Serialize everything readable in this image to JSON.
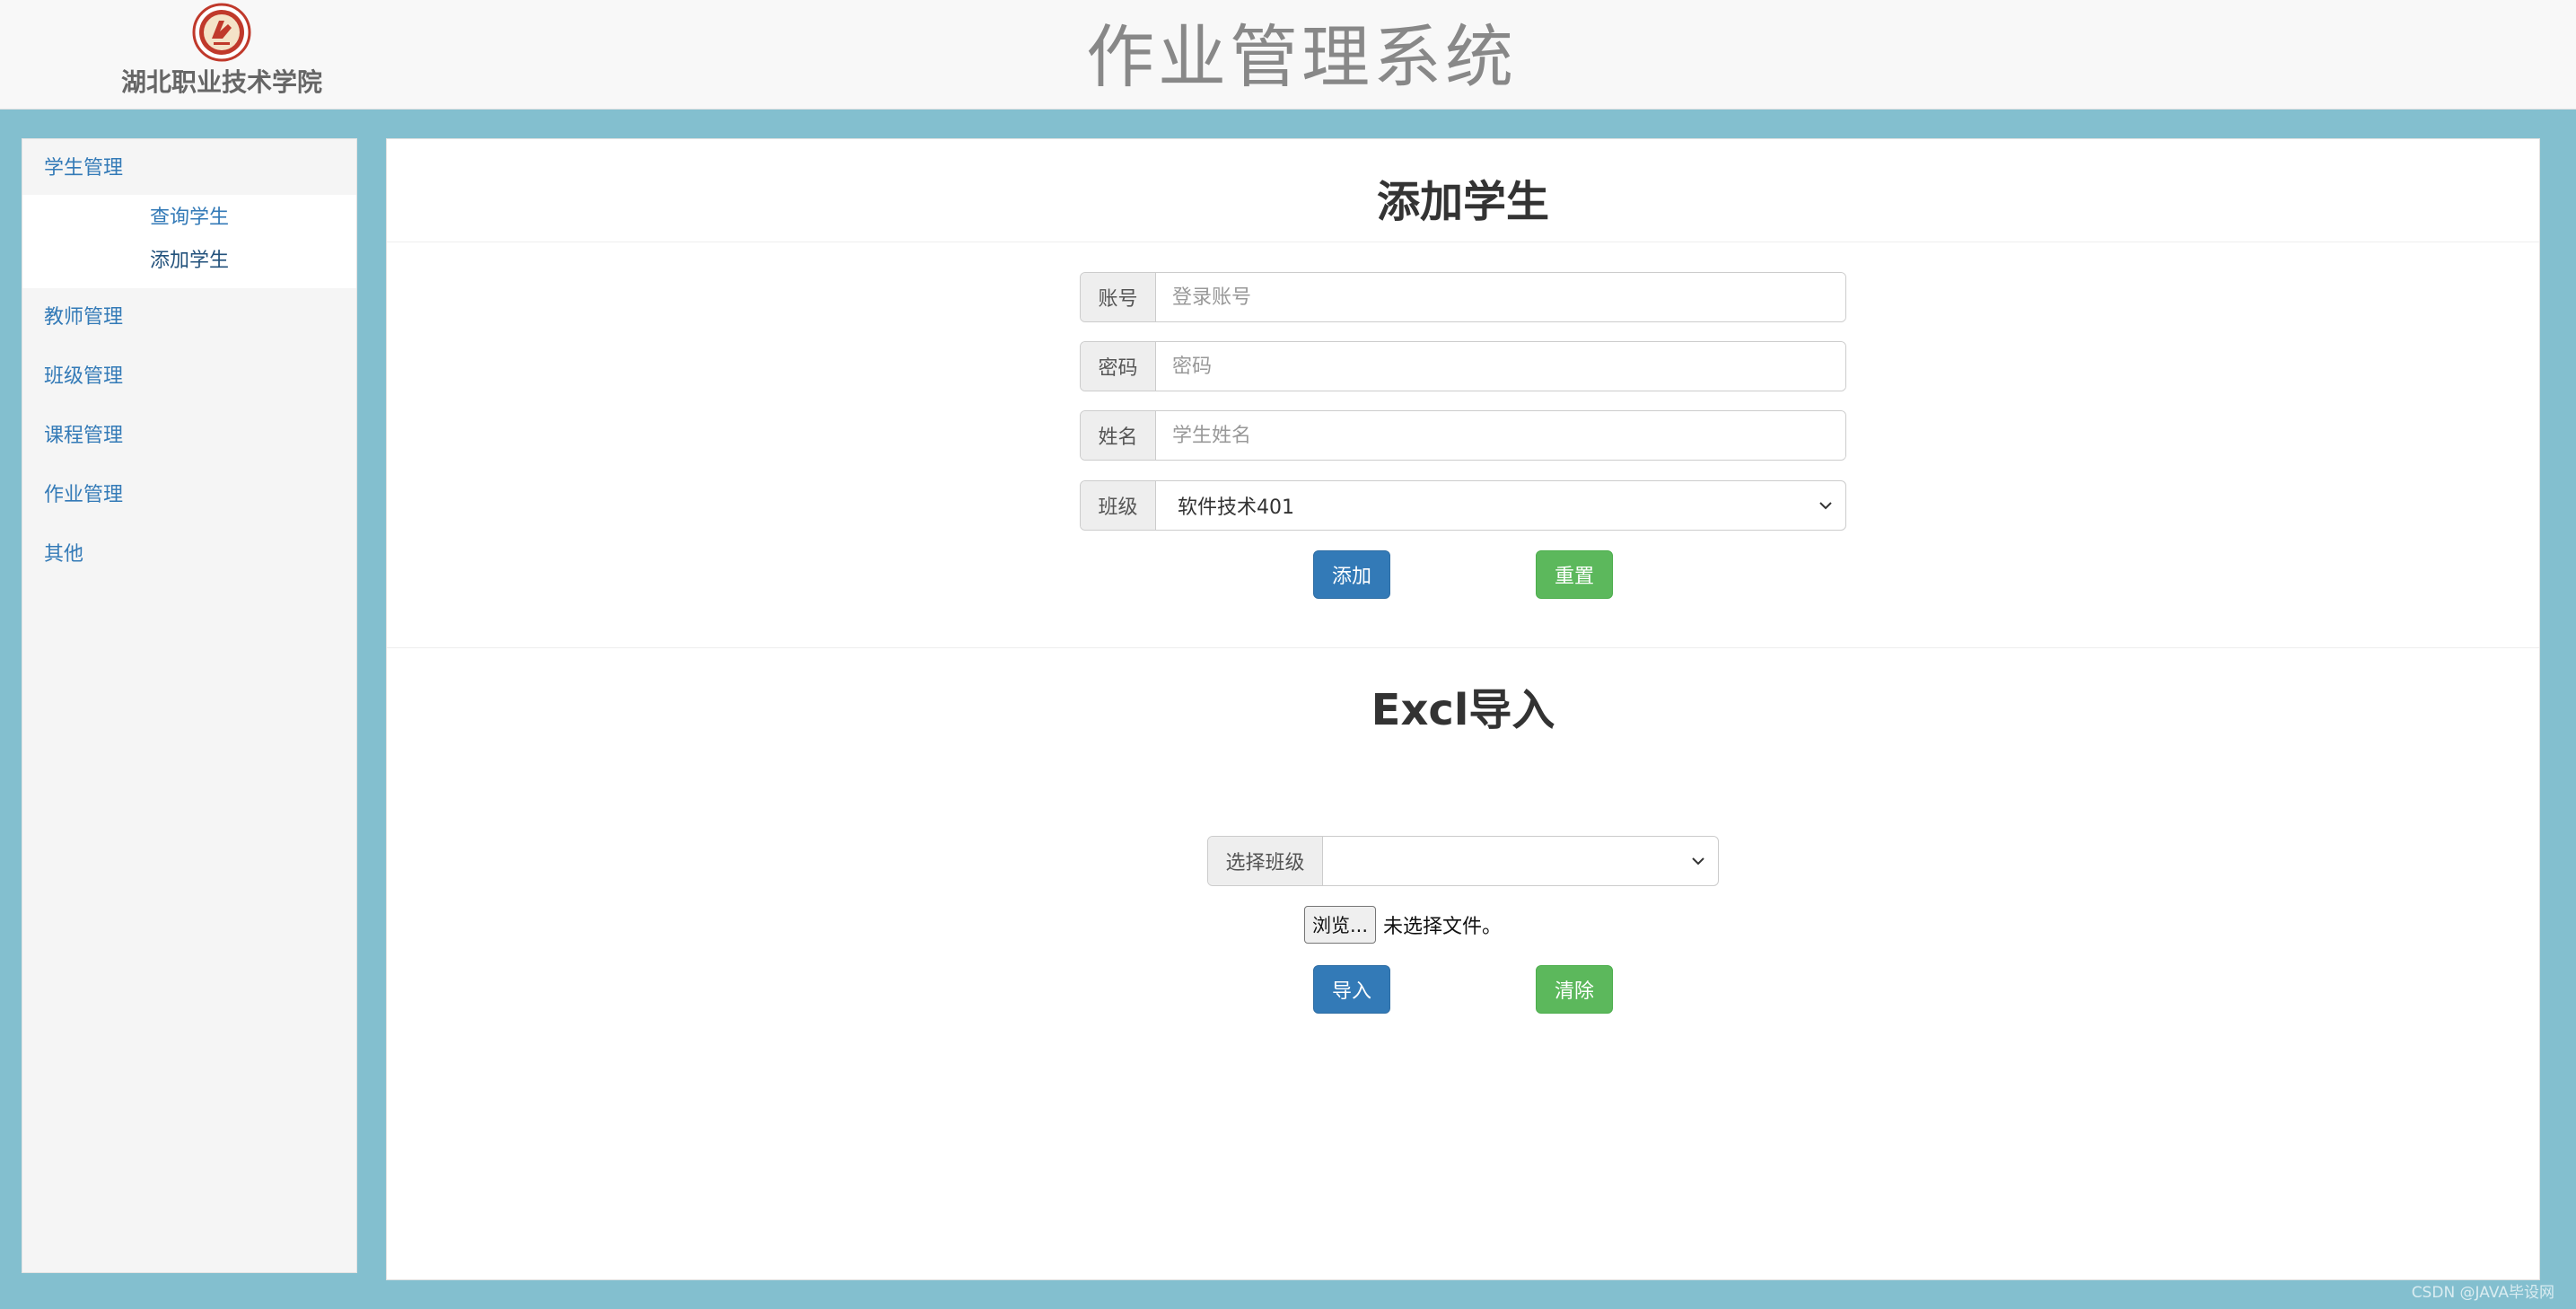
{
  "header": {
    "school_name": "湖北职业技术学院",
    "app_title": "作业管理系统",
    "logo_icon": "school-emblem-icon"
  },
  "sidebar": {
    "groups": [
      {
        "label": "学生管理",
        "expanded": true,
        "children": [
          {
            "label": "查询学生",
            "active": false
          },
          {
            "label": "添加学生",
            "active": true
          }
        ]
      },
      {
        "label": "教师管理"
      },
      {
        "label": "班级管理"
      },
      {
        "label": "课程管理"
      },
      {
        "label": "作业管理"
      },
      {
        "label": "其他"
      }
    ]
  },
  "add_student": {
    "title": "添加学生",
    "account": {
      "label": "账号",
      "placeholder": "登录账号"
    },
    "password": {
      "label": "密码",
      "placeholder": "密码"
    },
    "name": {
      "label": "姓名",
      "placeholder": "学生姓名"
    },
    "class": {
      "label": "班级",
      "selected": "软件技术401"
    },
    "add_button": "添加",
    "reset_button": "重置"
  },
  "excel_import": {
    "title": "Excl导入",
    "select_class_label": "选择班级",
    "select_class_value": "",
    "browse_button": "浏览...",
    "file_status": "未选择文件。",
    "import_button": "导入",
    "clear_button": "清除"
  },
  "watermark": "CSDN @JAVA毕设网",
  "colors": {
    "page_background": "#83bfcf",
    "link": "#337ab7",
    "primary": "#337ab7",
    "success": "#5cb85c"
  }
}
